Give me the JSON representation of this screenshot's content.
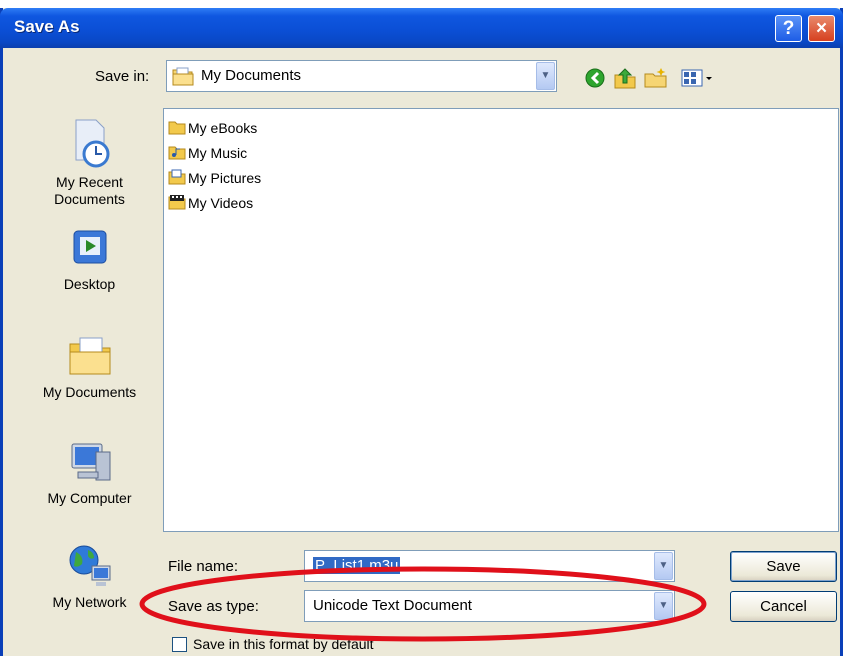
{
  "window": {
    "title": "Save As",
    "help_glyph": "?",
    "close_glyph": "×"
  },
  "save_in": {
    "label": "Save in:",
    "value": "My Documents"
  },
  "toolbar": {
    "icons": [
      "back-icon",
      "up-folder-icon",
      "new-folder-icon",
      "views-menu-icon"
    ]
  },
  "places": [
    {
      "label": "My Recent Documents",
      "icon": "recent-documents-icon"
    },
    {
      "label": "Desktop",
      "icon": "desktop-icon"
    },
    {
      "label": "My Documents",
      "icon": "my-documents-icon"
    },
    {
      "label": "My Computer",
      "icon": "my-computer-icon"
    },
    {
      "label": "My Network",
      "icon": "my-network-icon"
    }
  ],
  "files": [
    {
      "name": "My eBooks",
      "icon": "folder-icon"
    },
    {
      "name": "My Music",
      "icon": "music-folder-icon"
    },
    {
      "name": "My Pictures",
      "icon": "pictures-folder-icon"
    },
    {
      "name": "My Videos",
      "icon": "videos-folder-icon"
    }
  ],
  "file_name": {
    "label": "File name:",
    "value": "P_List1.m3u"
  },
  "save_as_type": {
    "label": "Save as type:",
    "value": "Unicode Text Document"
  },
  "buttons": {
    "save": "Save",
    "cancel": "Cancel"
  },
  "default_format": {
    "label": "Save in this format by default",
    "checked": false
  },
  "colors": {
    "title_bar": "#0b4fd6",
    "dialog_bg": "#ece9d8",
    "selection": "#316ac5",
    "highlight_ellipse": "#e0101a"
  }
}
